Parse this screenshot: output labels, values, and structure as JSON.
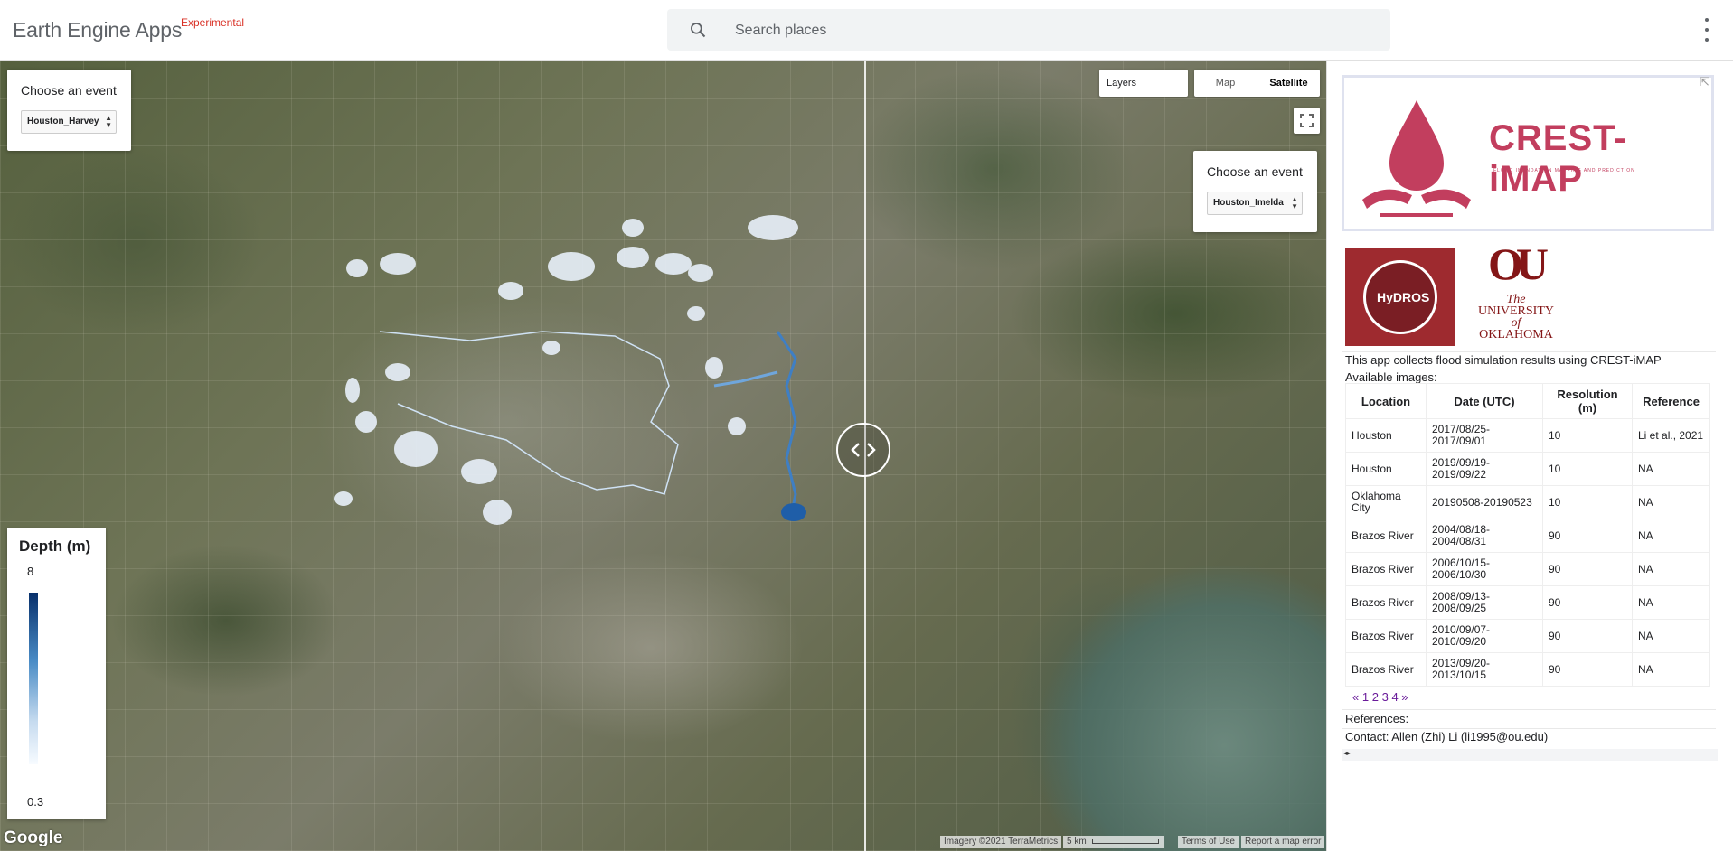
{
  "header": {
    "title": "Earth Engine Apps",
    "badge": "Experimental",
    "search_placeholder": "Search places"
  },
  "map": {
    "left_panel": {
      "label": "Choose an event",
      "selected": "Houston_Harvey"
    },
    "right_panel": {
      "label": "Choose an event",
      "selected": "Houston_Imelda"
    },
    "layers_label": "Layers",
    "map_type": {
      "map": "Map",
      "satellite": "Satellite",
      "active": "Satellite"
    },
    "legend": {
      "title": "Depth (m)",
      "max": "8",
      "min": "0.3"
    },
    "google_logo": "Google",
    "attribution": {
      "imagery": "Imagery ©2021 TerraMetrics",
      "scale": "5 km",
      "terms": "Terms of Use",
      "report": "Report a map error"
    },
    "colors": {
      "depth_high": "#08306b",
      "depth_low": "#f7fbff"
    }
  },
  "sidebar": {
    "logo_text": "CREST-iMAP",
    "logo_subtitle": "FLOOD INUNDATION MAPPING AND PREDICTION",
    "hydros_text": "HyDROS",
    "ou_mark": "OU",
    "ou_text": {
      "the": "The",
      "university": "UNIVERSITY",
      "of": "of",
      "oklahoma": "OKLAHOMA"
    },
    "intro": "This app collects flood simulation results using CREST-iMAP",
    "available": "Available images:",
    "table": {
      "headers": [
        "Location",
        "Date (UTC)",
        "Resolution (m)",
        "Reference"
      ],
      "rows": [
        [
          "Houston",
          "2017/08/25-2017/09/01",
          "10",
          "Li et al., 2021"
        ],
        [
          "Houston",
          "2019/09/19-2019/09/22",
          "10",
          "NA"
        ],
        [
          "Oklahoma City",
          "20190508-20190523",
          "10",
          "NA"
        ],
        [
          "Brazos River",
          "2004/08/18-2004/08/31",
          "90",
          "NA"
        ],
        [
          "Brazos River",
          "2006/10/15-2006/10/30",
          "90",
          "NA"
        ],
        [
          "Brazos River",
          "2008/09/13-2008/09/25",
          "90",
          "NA"
        ],
        [
          "Brazos River",
          "2010/09/07-2010/09/20",
          "90",
          "NA"
        ],
        [
          "Brazos River",
          "2013/09/20-2013/10/15",
          "90",
          "NA"
        ]
      ]
    },
    "pager": {
      "prev": "«",
      "pages": [
        "1",
        "2",
        "3",
        "4"
      ],
      "next": "»"
    },
    "references": "References:",
    "contact": "Contact: Allen (Zhi) Li (li1995@ou.edu)"
  }
}
